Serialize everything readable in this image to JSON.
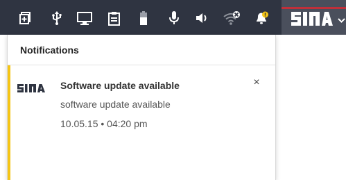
{
  "tray": {
    "icons": [
      "window-plus-icon",
      "usb-icon",
      "monitor-icon",
      "clipboard-icon",
      "battery-icon",
      "microphone-icon",
      "speaker-icon",
      "wifi-error-icon",
      "notification-bell-icon"
    ]
  },
  "brand": {
    "name": "SINA"
  },
  "panel": {
    "title": "Notifications",
    "notifications": [
      {
        "title": "Software update available",
        "body": "software update available",
        "time": "10.05.15 • 04:20 pm",
        "close_symbol": "×"
      }
    ]
  },
  "colors": {
    "topbar": "#2f3441",
    "brand_bg": "#4a4f5c",
    "brand_accent": "#c0303a",
    "notification_stripe": "#f5c515",
    "bell_badge": "#f5c515"
  }
}
